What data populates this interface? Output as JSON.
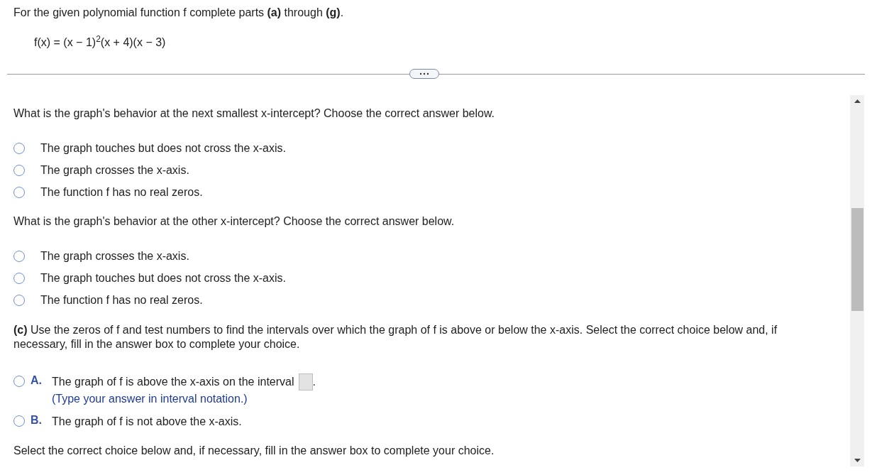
{
  "instruction": "For the given polynomial function f complete parts **(a)** through **(g)**.",
  "function": "f(x) = (x − 1)$^{2}$(x + 4)(x − 3)",
  "questions": [
    {
      "prompt": "What is the graph's behavior at the next smallest x-intercept? Choose the correct answer below.",
      "options": [
        {
          "label": "The graph touches but does not cross the x-axis.",
          "selected": false
        },
        {
          "label": "The graph crosses the x-axis.",
          "selected": false
        },
        {
          "label": "The function f has no real zeros.",
          "selected": false
        }
      ]
    },
    {
      "prompt": "What is the graph's behavior at the other x-intercept? Choose the correct answer below.",
      "options": [
        {
          "label": "The graph crosses the x-axis.",
          "selected": false
        },
        {
          "label": "The graph touches but does not cross the x-axis.",
          "selected": false
        },
        {
          "label": "The function f has no real zeros.",
          "selected": false
        }
      ]
    }
  ],
  "part_c": {
    "prompt": "**(c)** Use the zeros of f and test numbers to find the intervals over which the graph of f is above or below the x-axis. Select the correct choice below and, if necessary, fill in the answer box to complete your choice.",
    "choices": [
      {
        "letter": "A.",
        "text": "The graph of f is above the x-axis on the interval",
        "answer_box": true,
        "after": ".",
        "hint": "(Type your answer in interval notation.)",
        "selected": false
      },
      {
        "letter": "B.",
        "text": "The graph of f is not above the x-axis.",
        "answer_box": false,
        "selected": false
      }
    ]
  },
  "next_prompt": "Select the correct choice below and, if necessary, fill in the answer box to complete your choice."
}
